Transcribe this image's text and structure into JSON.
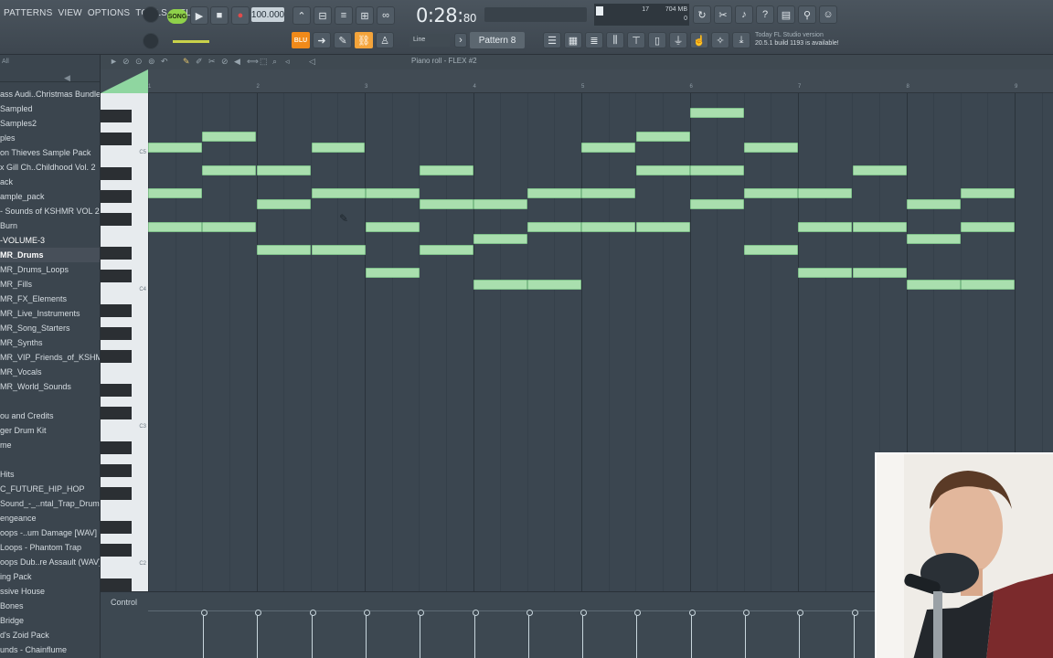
{
  "menu": [
    "PATTERNS",
    "VIEW",
    "OPTIONS",
    "TOOLS",
    "HELP"
  ],
  "transport": {
    "song_toggle": "SONG",
    "tempo": "100.000",
    "time_main": "0:28:",
    "time_sub": "80"
  },
  "cpu": {
    "a": "17",
    "b": "704 MB",
    "c": "0"
  },
  "toolbar2": {
    "orange_label": "BLU",
    "snap": "Line",
    "pattern": "Pattern 8",
    "news_line1": "Today  FL Studio version",
    "news_line2": "20.5.1 build 1193 is available!"
  },
  "browser": {
    "header": "All",
    "items": [
      {
        "label": "ass Audi..Christmas Bundle",
        "kind": "item"
      },
      {
        "label": "Sampled",
        "kind": "item"
      },
      {
        "label": "Samples2",
        "kind": "item"
      },
      {
        "label": "ples",
        "kind": "item"
      },
      {
        "label": "on Thieves Sample Pack",
        "kind": "item"
      },
      {
        "label": "x Gill Ch..Childhood Vol. 2",
        "kind": "item"
      },
      {
        "label": "ack",
        "kind": "item"
      },
      {
        "label": "ample_pack",
        "kind": "item"
      },
      {
        "label": "- Sounds of KSHMR VOL 2",
        "kind": "item"
      },
      {
        "label": "Burn",
        "kind": "item"
      },
      {
        "label": "-VOLUME-3",
        "kind": "grp"
      },
      {
        "label": "MR_Drums",
        "kind": "sel"
      },
      {
        "label": "MR_Drums_Loops",
        "kind": "item"
      },
      {
        "label": "MR_Fills",
        "kind": "item"
      },
      {
        "label": "MR_FX_Elements",
        "kind": "item"
      },
      {
        "label": "MR_Live_Instruments",
        "kind": "item"
      },
      {
        "label": "MR_Song_Starters",
        "kind": "item"
      },
      {
        "label": "MR_Synths",
        "kind": "item"
      },
      {
        "label": "MR_VIP_Friends_of_KSHMR",
        "kind": "item"
      },
      {
        "label": "MR_Vocals",
        "kind": "item"
      },
      {
        "label": "MR_World_Sounds",
        "kind": "item"
      },
      {
        "label": "",
        "kind": "item"
      },
      {
        "label": "ou and Credits",
        "kind": "item"
      },
      {
        "label": "ger Drum Kit",
        "kind": "item"
      },
      {
        "label": "me",
        "kind": "item"
      },
      {
        "label": "",
        "kind": "item"
      },
      {
        "label": "Hits",
        "kind": "item"
      },
      {
        "label": "C_FUTURE_HIP_HOP",
        "kind": "item"
      },
      {
        "label": "Sound_-_..ntal_Trap_Drums",
        "kind": "item"
      },
      {
        "label": "engeance",
        "kind": "item"
      },
      {
        "label": "oops -..um Damage [WAV]",
        "kind": "item"
      },
      {
        "label": "Loops - Phantom Trap",
        "kind": "item"
      },
      {
        "label": "oops Dub..re Assault (WAV)",
        "kind": "item"
      },
      {
        "label": "ing Pack",
        "kind": "item"
      },
      {
        "label": "ssive House",
        "kind": "item"
      },
      {
        "label": "Bones",
        "kind": "item"
      },
      {
        "label": "Bridge",
        "kind": "item"
      },
      {
        "label": "d's Zoid Pack",
        "kind": "item"
      },
      {
        "label": "unds - Chainflume",
        "kind": "item"
      }
    ]
  },
  "piano_roll": {
    "title": "Piano roll - FLEX #2",
    "octave_labels": [
      "C5",
      "C4",
      "C3",
      "C2"
    ],
    "control_label": "Control",
    "timeline_numbers": [
      "1",
      "2",
      "3",
      "4",
      "5",
      "6",
      "7",
      "8",
      "9"
    ]
  },
  "colors": {
    "note_fill": "#a9dfae",
    "accent_orange": "#f08a1a",
    "song_green": "#8fd14a",
    "background": "#3b4650"
  },
  "icons": {
    "play": "play-icon",
    "stop": "stop-icon",
    "record": "record-icon",
    "pencil": "pencil-icon",
    "cursor": "pencil-cursor-icon"
  }
}
